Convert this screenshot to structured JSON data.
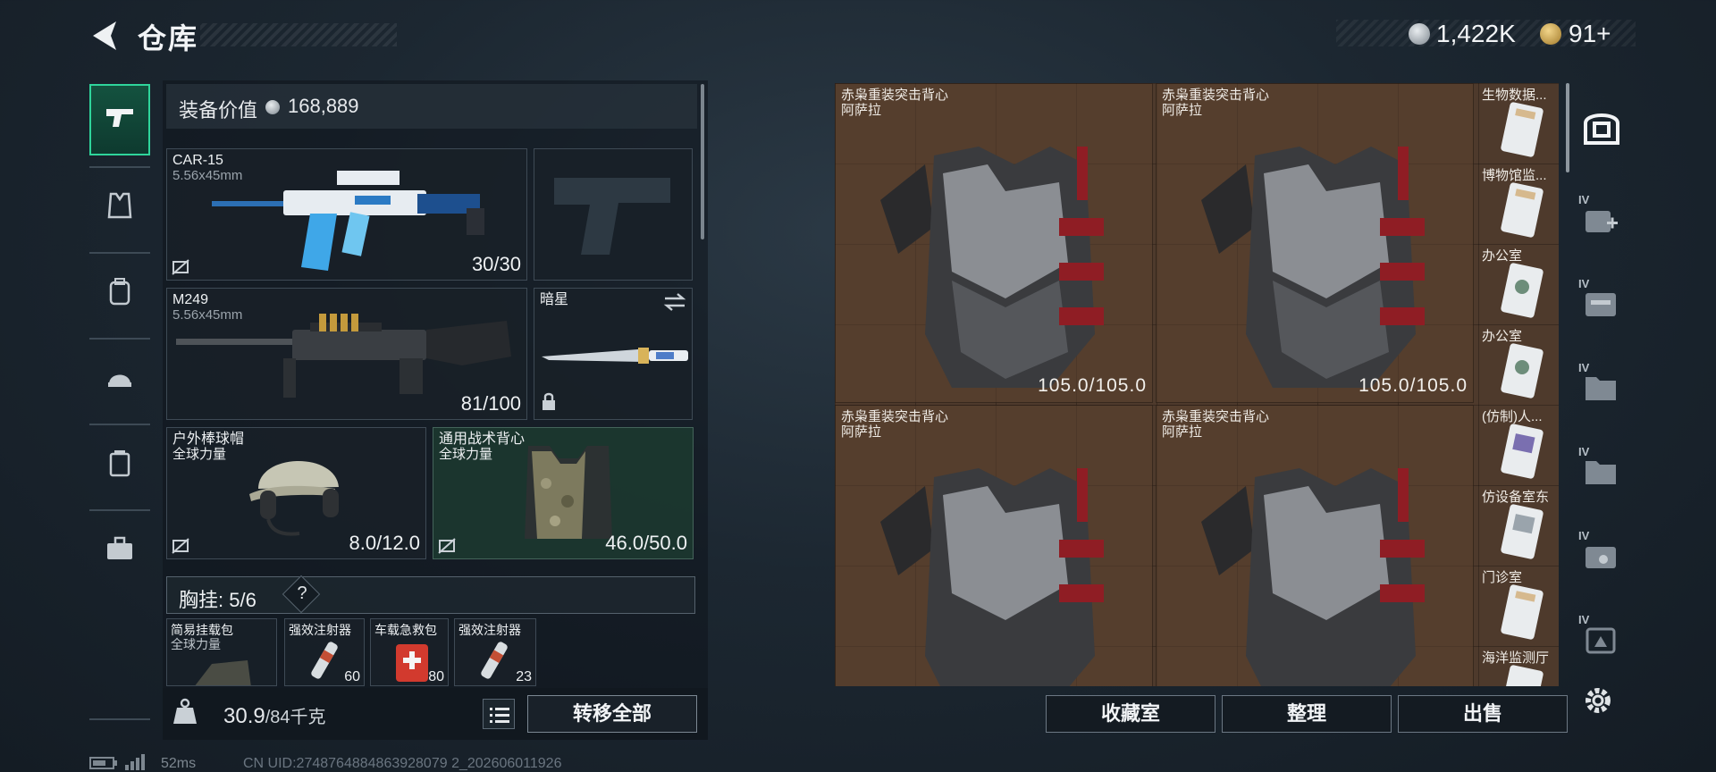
{
  "header": {
    "title": "仓库",
    "currencies": [
      {
        "icon": "silver-coin-icon",
        "value": "1,422K"
      },
      {
        "icon": "gold-coin-icon",
        "value": "91+"
      }
    ]
  },
  "equipment": {
    "value_label": "装备价值",
    "value": "168,889",
    "primary_weapon": {
      "name": "CAR-15",
      "caliber": "5.56x45mm",
      "ammo": "30/30"
    },
    "secondary_weapon": {
      "name": "M249",
      "caliber": "5.56x45mm",
      "ammo": "81/100"
    },
    "melee": {
      "name": "暗星"
    },
    "helmet": {
      "name": "户外棒球帽",
      "faction": "全球力量",
      "durability": "8.0/12.0"
    },
    "armor": {
      "name": "通用战术背心",
      "faction": "全球力量",
      "durability": "46.0/50.0"
    },
    "chest_rig": {
      "label": "胸挂:",
      "capacity": "5/6",
      "help": "?",
      "items": [
        {
          "name": "简易挂载包",
          "sub": "全球力量",
          "count": ""
        },
        {
          "name": "强效注射器",
          "sub": "",
          "count": "60"
        },
        {
          "name": "车载急救包",
          "sub": "",
          "count": "80"
        },
        {
          "name": "强效注射器",
          "sub": "",
          "count": "23"
        }
      ]
    }
  },
  "weight": {
    "current": "30.9",
    "max": "/84千克"
  },
  "buttons": {
    "transfer_all": "转移全部",
    "collection": "收藏室",
    "organize": "整理",
    "sell": "出售"
  },
  "storage": {
    "vests": [
      {
        "name": "赤枭重装突击背心",
        "sub": "阿萨拉",
        "durability": "105.0/105.0"
      },
      {
        "name": "赤枭重装突击背心",
        "sub": "阿萨拉",
        "durability": "105.0/105.0"
      },
      {
        "name": "赤枭重装突击背心",
        "sub": "阿萨拉",
        "durability": ""
      },
      {
        "name": "赤枭重装突击背心",
        "sub": "阿萨拉",
        "durability": ""
      }
    ],
    "cards": [
      {
        "name": "生物数据..."
      },
      {
        "name": "博物馆监..."
      },
      {
        "name": "办公室"
      },
      {
        "name": "办公室"
      },
      {
        "name": "(仿制)人..."
      },
      {
        "name": "仿设备室东"
      },
      {
        "name": "门诊室"
      },
      {
        "name": "海洋监测厅"
      }
    ]
  },
  "right_rail": {
    "tier_label": "IV"
  },
  "status": {
    "ping": "52ms",
    "uid": "CN UID:2748764884863928079 2_202606011926"
  },
  "colors": {
    "accent": "#2fd59b",
    "storage_bg": "#4e3a2c",
    "vest_strap": "#8f1d24"
  }
}
